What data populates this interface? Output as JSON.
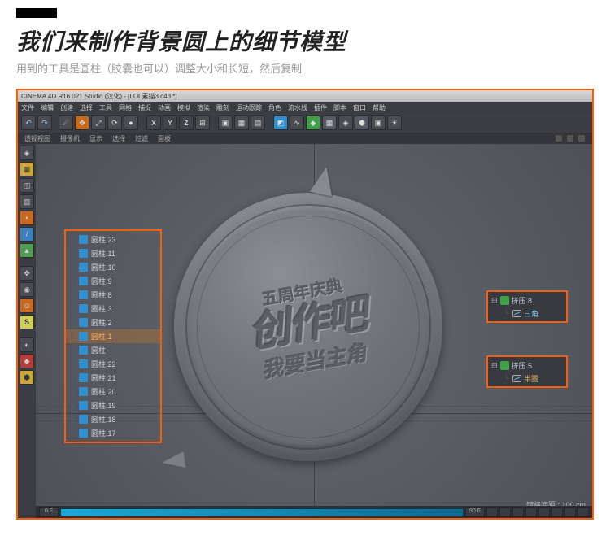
{
  "header": {
    "title": "我们来制作背景圆上的细节模型",
    "subtitle": "用到的工具是圆柱（胶囊也可以）调整大小和长短，然后复制"
  },
  "window": {
    "title": "CINEMA 4D R16.021 Studio (汉化) - [LOL素描3.c4d *]"
  },
  "menu": {
    "items": [
      "文件",
      "编辑",
      "创建",
      "选择",
      "工具",
      "网格",
      "捕捉",
      "动画",
      "模拟",
      "渲染",
      "雕刻",
      "运动跟踪",
      "角色",
      "流水线",
      "插件",
      "脚本",
      "窗口",
      "帮助"
    ]
  },
  "toolbar_xyz": {
    "x": "X",
    "y": "Y",
    "z": "Z"
  },
  "subbar": {
    "items": [
      "摄像机",
      "显示",
      "选择",
      "过滤",
      "面板"
    ],
    "view_label": "透视视图"
  },
  "objects": {
    "items": [
      {
        "label": "圆柱.23"
      },
      {
        "label": "圆柱.11"
      },
      {
        "label": "圆柱.10"
      },
      {
        "label": "圆柱.9"
      },
      {
        "label": "圆柱.8"
      },
      {
        "label": "圆柱.3"
      },
      {
        "label": "圆柱.2"
      },
      {
        "label": "圆柱.1",
        "active": true
      },
      {
        "label": "圆柱"
      },
      {
        "label": "圆柱.22"
      },
      {
        "label": "圆柱.21"
      },
      {
        "label": "圆柱.20"
      },
      {
        "label": "圆柱.19"
      },
      {
        "label": "圆柱.18"
      },
      {
        "label": "圆柱.17"
      }
    ]
  },
  "callout_a": {
    "parent": "挤压.8",
    "child": "三角"
  },
  "callout_b": {
    "parent": "挤压.5",
    "child": "半圆"
  },
  "medallion": {
    "top": "五周年庆典",
    "main": "创作吧",
    "sub": "我要当主角"
  },
  "status": {
    "hint": "网格间距 : 100 cm"
  },
  "timeline": {
    "frame_start": "0 F",
    "frame_end": "90 F"
  },
  "dock_s": "S"
}
